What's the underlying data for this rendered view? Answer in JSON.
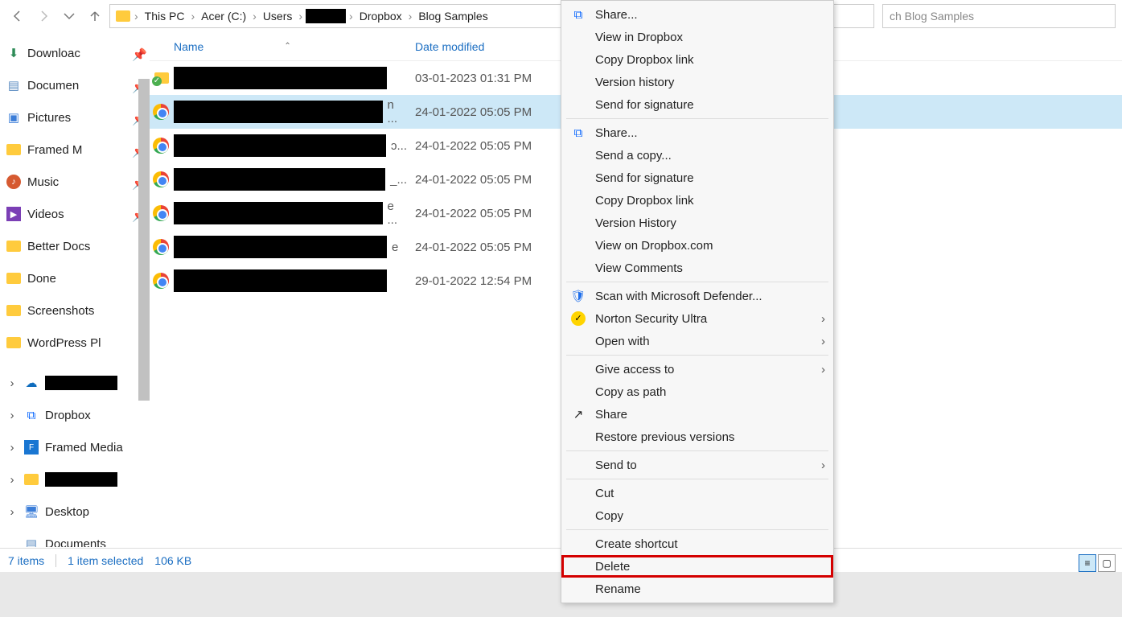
{
  "breadcrumbs": [
    "This PC",
    "Acer (C:)",
    "Users",
    "[REDACTED]",
    "Dropbox",
    "Blog Samples"
  ],
  "search_placeholder": "ch Blog Samples",
  "columns": {
    "name": "Name",
    "date": "Date modified"
  },
  "sidebar": {
    "quick": [
      {
        "icon": "download",
        "label": "Downloac",
        "pinned": true
      },
      {
        "icon": "document",
        "label": "Documen",
        "pinned": true
      },
      {
        "icon": "pictures",
        "label": "Pictures",
        "pinned": true
      },
      {
        "icon": "folder",
        "label": "Framed M",
        "pinned": true
      },
      {
        "icon": "music",
        "label": "Music",
        "pinned": true
      },
      {
        "icon": "videos",
        "label": "Videos",
        "pinned": true
      },
      {
        "icon": "folder",
        "label": "Better Docs",
        "pinned": false
      },
      {
        "icon": "folder",
        "label": "Done",
        "pinned": false
      },
      {
        "icon": "folder",
        "label": "Screenshots",
        "pinned": false
      },
      {
        "icon": "folder",
        "label": "WordPress Pl",
        "pinned": false
      }
    ],
    "tree": [
      {
        "icon": "onedrive",
        "label": "[REDACTED]",
        "chev": true,
        "redact": true
      },
      {
        "icon": "dropbox",
        "label": "Dropbox",
        "chev": true
      },
      {
        "icon": "framed",
        "label": "Framed Media",
        "chev": true
      },
      {
        "icon": "folder",
        "label": "[REDACTED]",
        "chev": true,
        "redact": true
      },
      {
        "icon": "desktop",
        "label": "Desktop",
        "chev": true
      },
      {
        "icon": "document",
        "label": "Documents",
        "chev": false
      }
    ]
  },
  "files": [
    {
      "type": "folder",
      "date": "03-01-2023 01:31 PM",
      "tail": "",
      "selected": false
    },
    {
      "type": "chrome",
      "date": "24-01-2022 05:05 PM",
      "tail": "n ...",
      "selected": true
    },
    {
      "type": "chrome",
      "date": "24-01-2022 05:05 PM",
      "tail": "ɔ...",
      "selected": false
    },
    {
      "type": "chrome",
      "date": "24-01-2022 05:05 PM",
      "tail": "_...",
      "selected": false
    },
    {
      "type": "chrome",
      "date": "24-01-2022 05:05 PM",
      "tail": "e ...",
      "selected": false
    },
    {
      "type": "chrome",
      "date": "24-01-2022 05:05 PM",
      "tail": "e",
      "selected": false
    },
    {
      "type": "chrome",
      "date": "29-01-2022 12:54 PM",
      "tail": "",
      "selected": false
    }
  ],
  "context_menu": {
    "groups": [
      [
        {
          "icon": "dropbox",
          "label": "Share..."
        },
        {
          "label": "View in Dropbox"
        },
        {
          "label": "Copy Dropbox link"
        },
        {
          "label": "Version history"
        },
        {
          "label": "Send for signature"
        }
      ],
      [
        {
          "icon": "dropbox",
          "label": "Share..."
        },
        {
          "label": "Send a copy..."
        },
        {
          "label": "Send for signature"
        },
        {
          "label": "Copy Dropbox link"
        },
        {
          "label": "Version History"
        },
        {
          "label": "View on Dropbox.com"
        },
        {
          "label": "View Comments"
        }
      ],
      [
        {
          "icon": "defender",
          "label": "Scan with Microsoft Defender..."
        },
        {
          "icon": "norton",
          "label": "Norton Security Ultra",
          "arrow": true
        },
        {
          "label": "Open with",
          "arrow": true
        }
      ],
      [
        {
          "label": "Give access to",
          "arrow": true
        },
        {
          "label": "Copy as path"
        },
        {
          "icon": "share",
          "label": "Share"
        },
        {
          "label": "Restore previous versions"
        }
      ],
      [
        {
          "label": "Send to",
          "arrow": true
        }
      ],
      [
        {
          "label": "Cut"
        },
        {
          "label": "Copy"
        }
      ],
      [
        {
          "label": "Create shortcut"
        },
        {
          "label": "Delete",
          "highlight": true
        },
        {
          "label": "Rename"
        }
      ]
    ]
  },
  "status": {
    "items": "7 items",
    "selected": "1 item selected",
    "size": "106 KB"
  }
}
